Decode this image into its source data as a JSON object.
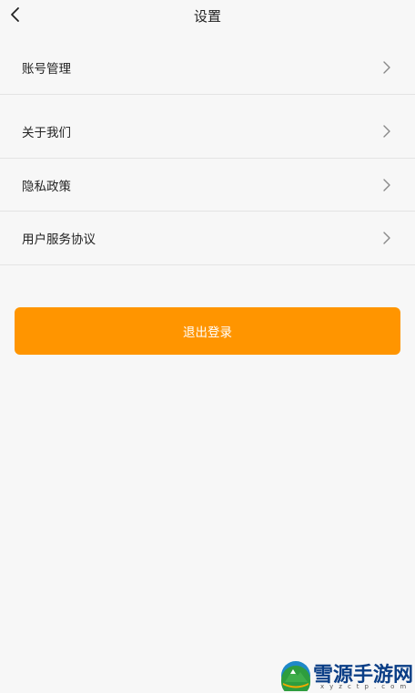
{
  "header": {
    "title": "设置"
  },
  "menu": {
    "items": [
      {
        "label": "账号管理"
      },
      {
        "label": "关于我们"
      },
      {
        "label": "隐私政策"
      },
      {
        "label": "用户服务协议"
      }
    ]
  },
  "logout": {
    "label": "退出登录"
  },
  "watermark": {
    "text": "雪源手游网",
    "subtext": "xyzctp.com"
  },
  "colors": {
    "accent": "#ff9500",
    "background": "#f7f7f7",
    "divider": "#e4e4e4"
  },
  "icons": {
    "back": "chevron-left-icon",
    "row": "chevron-right-icon"
  }
}
